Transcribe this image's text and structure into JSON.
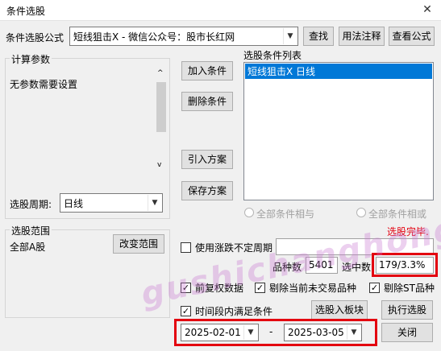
{
  "window": {
    "title": "条件选股"
  },
  "formula": {
    "label": "条件选股公式",
    "value": "短线狙击X  -  微信公众号：股市长红网",
    "find_button": "查找",
    "usage_button": "用法注释",
    "view_button": "查看公式"
  },
  "params": {
    "group_title": "计算参数",
    "text": "无参数需要设置",
    "period_label": "选股周期:",
    "period_value": "日线"
  },
  "actions": {
    "add": "加入条件",
    "delete": "删除条件",
    "import": "引入方案",
    "save": "保存方案"
  },
  "conditions": {
    "title": "选股条件列表",
    "items": [
      "短线狙击X  日线"
    ],
    "and_label": "全部条件相与",
    "or_label": "全部条件相或"
  },
  "scope": {
    "group_title": "选股范围",
    "value": "全部A股",
    "change_button": "改变范围"
  },
  "options": {
    "use_irregular_label": "使用涨跌不定周期",
    "status": "选股完毕.",
    "count_label": "品种数",
    "count_value": "5401",
    "selected_label": "选中数",
    "selected_value": "179/3.3%",
    "fq_label": "前复权数据",
    "exclude_untraded_label": "剔除当前未交易品种",
    "exclude_st_label": "剔除ST品种",
    "time_range_label": "时间段内满足条件",
    "start_date": "2025-02-01",
    "end_date": "2025-03-05",
    "date_separator": "-",
    "to_block_button": "选股入板块",
    "execute_button": "执行选股",
    "close_button": "关闭"
  },
  "watermark": "gushichanghong.com",
  "colors": {
    "selection": "#0078d7",
    "highlight_red": "#e3000f",
    "status_red": "#e3000f"
  }
}
